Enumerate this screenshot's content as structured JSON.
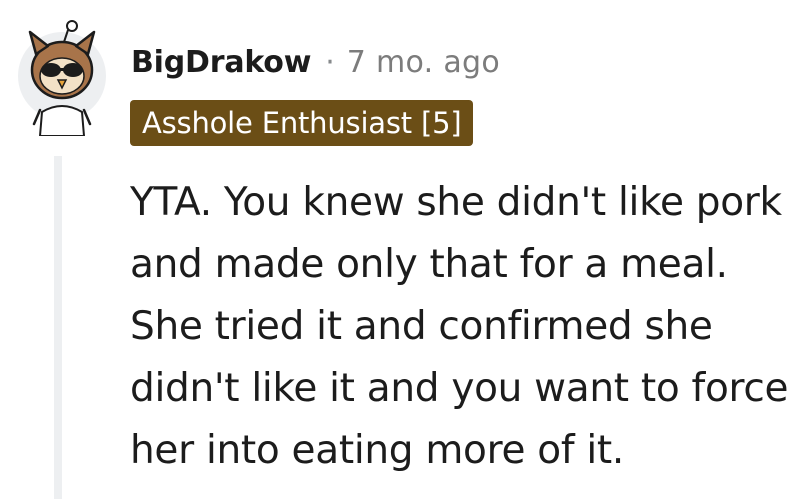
{
  "comment": {
    "username": "BigDrakow",
    "separator": "·",
    "timestamp": "7 mo. ago",
    "flair": "Asshole Enthusiast [5]",
    "body": "YTA. You knew she didn't like pork and made only that for a meal. She tried it and confirmed she didn't like it and you want to force her into eating more of it."
  },
  "colors": {
    "flair_background": "#6b4e16",
    "thread_line": "#edeff1",
    "text": "#1c1c1c",
    "meta": "#7c7c7c"
  },
  "icons": {
    "avatar": "snoo-owl-avatar-icon"
  }
}
